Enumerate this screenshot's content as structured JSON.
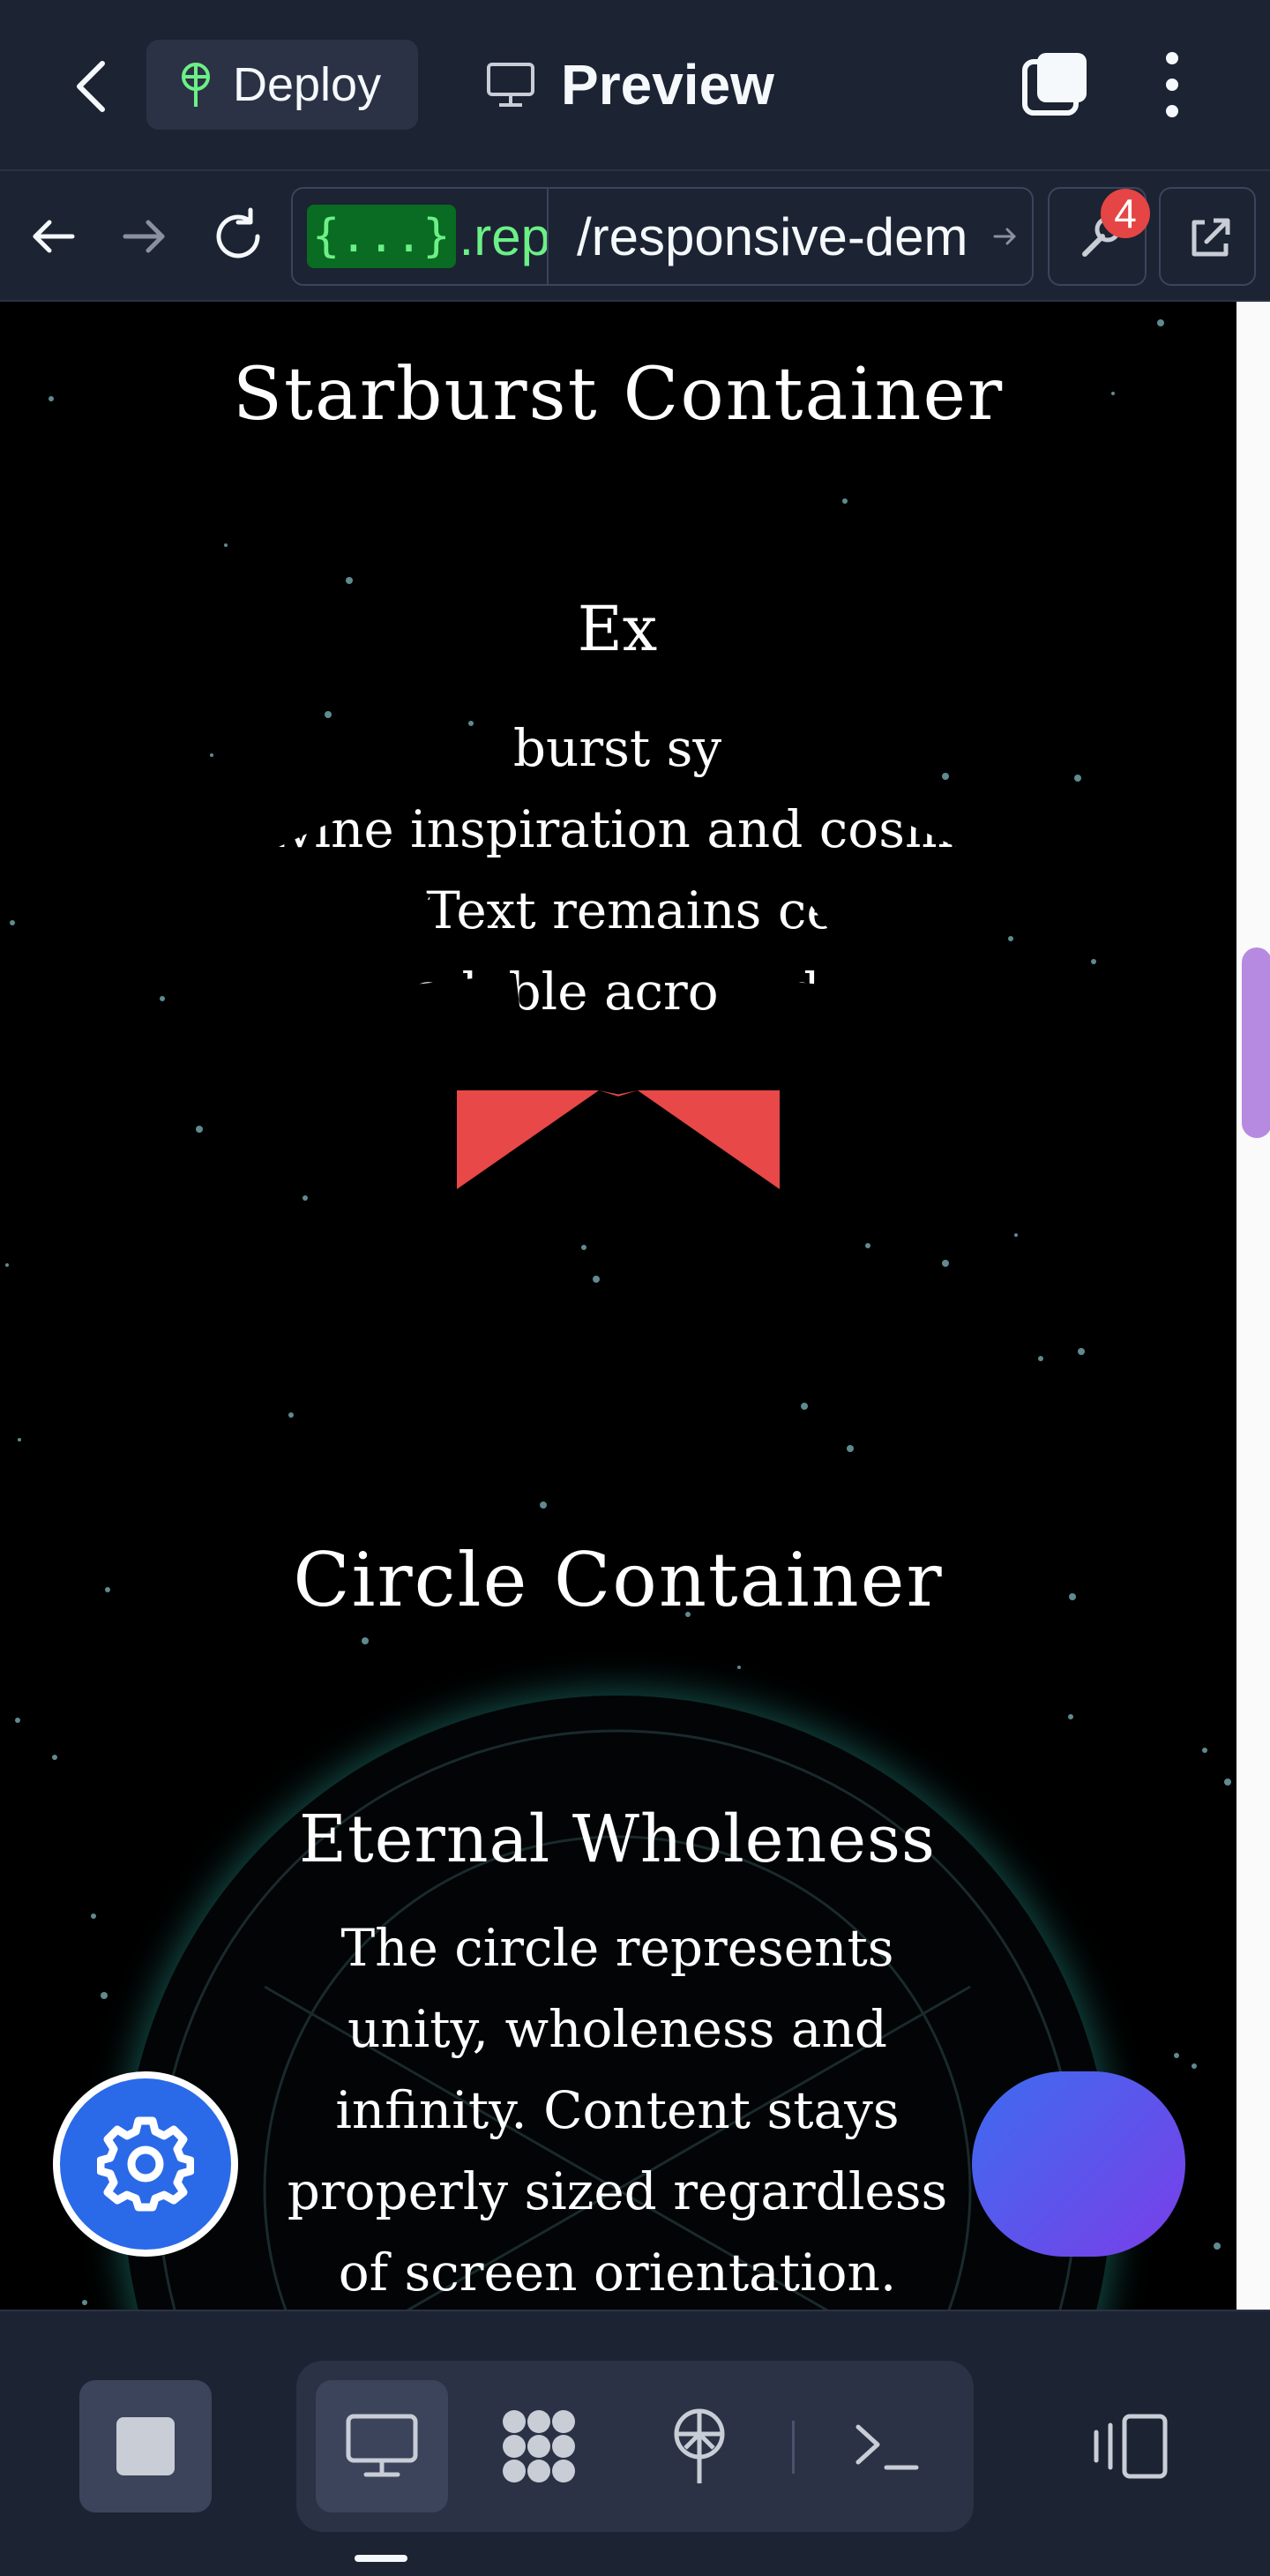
{
  "header": {
    "deploy_label": "Deploy",
    "preview_label": "Preview"
  },
  "browser": {
    "url_host_brace": "{...}",
    "url_host": ".replit",
    "url_path": "/responsive-dem",
    "issues_badge": "4"
  },
  "page": {
    "starburst_heading": "Starburst Container",
    "starburst_title": "Ex",
    "starburst_text": "burst sy\ndivine inspiration and cosmic\nrgy. Text remains cente\nadable across d",
    "starburst_button": "",
    "circle_heading": "Circle Container",
    "circle_title": "Eternal Wholeness",
    "circle_text": "The circle represents unity, wholeness and infinity. Content stays properly sized regardless of screen orientation."
  },
  "colors": {
    "app_bg": "#1c2333",
    "accent_green": "#6cf086",
    "badge_red": "#e54545",
    "starburst_button": "#e84848",
    "circle_glow": "#28a096",
    "settings_fab": "#2a6ae8",
    "scroll_thumb": "#b68ae0"
  },
  "icons": {
    "back": "chevron-left-icon",
    "deploy": "deploy-icon",
    "preview": "monitor-icon",
    "tabs": "tabs-icon",
    "menu": "kebab-icon",
    "nav_back": "arrow-left-icon",
    "nav_forward": "arrow-right-icon",
    "reload": "reload-icon",
    "url_go": "arrow-right-icon",
    "tools": "wrench-icon",
    "external": "external-link-icon",
    "settings": "gear-icon",
    "stop": "stop-icon",
    "webview": "monitor-icon",
    "workflows": "workflows-icon",
    "deployments": "deploy-icon",
    "shell": "terminal-icon",
    "devices": "devices-icon"
  }
}
